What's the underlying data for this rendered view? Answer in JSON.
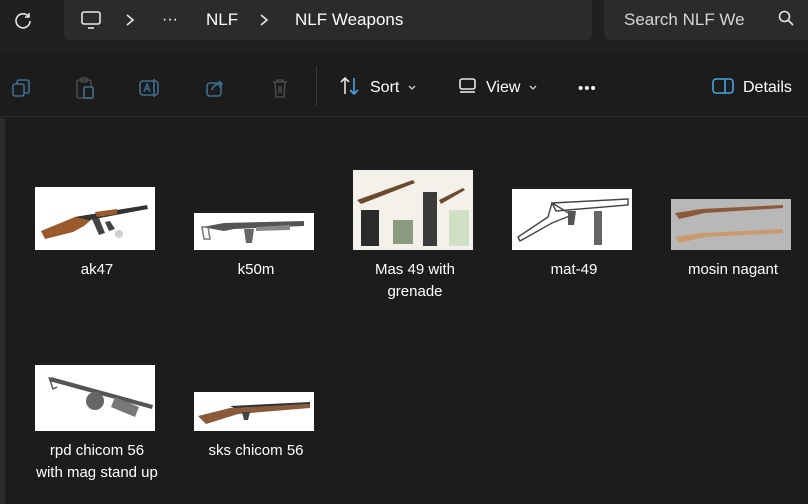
{
  "address": {
    "ellipsis": "···",
    "crumbs": [
      "NLF",
      "NLF Weapons"
    ]
  },
  "search": {
    "placeholder": "Search NLF We"
  },
  "toolbar": {
    "sort_label": "Sort",
    "view_label": "View",
    "more_label": "•••",
    "details_label": "Details"
  },
  "files": [
    {
      "name": "ak47"
    },
    {
      "name": "k50m"
    },
    {
      "name": "Mas 49 with grenade"
    },
    {
      "name": "mat-49"
    },
    {
      "name": "mosin nagant"
    },
    {
      "name": "rpd chicom 56 with mag stand up"
    },
    {
      "name": "sks chicom 56"
    }
  ],
  "colors": {
    "background": "#1c1c1c",
    "bar": "#2b2b2b",
    "accent_icon": "#4aa3df"
  }
}
